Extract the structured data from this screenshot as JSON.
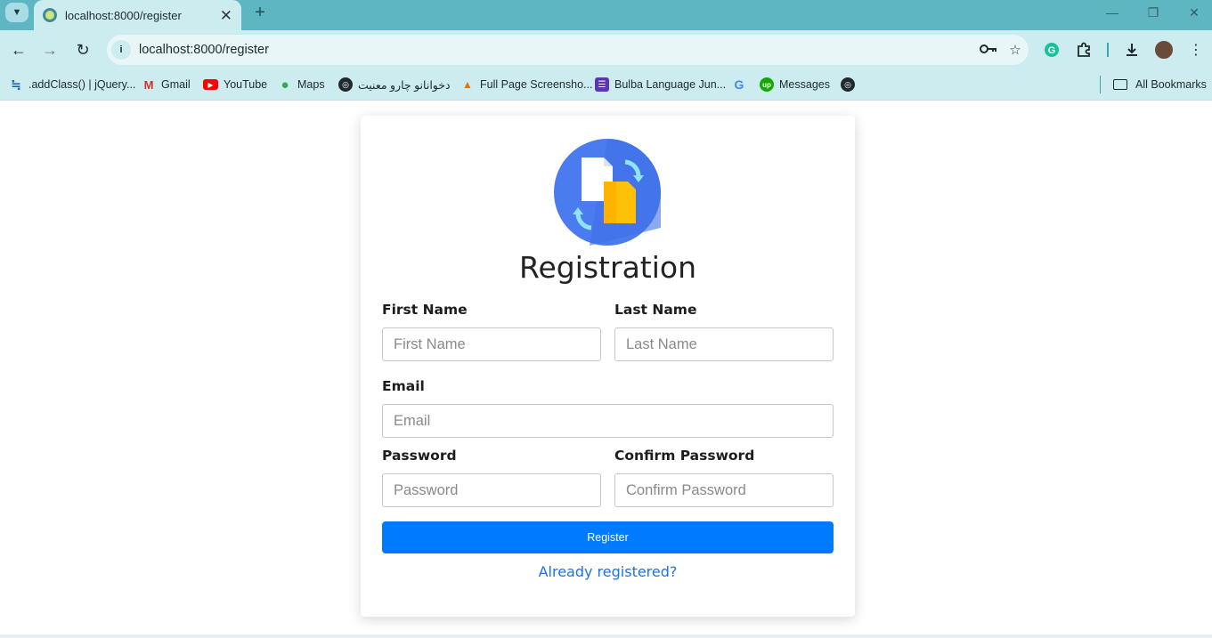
{
  "browser": {
    "tab_title": "localhost:8000/register",
    "url": "localhost:8000/register",
    "bookmarks": [
      {
        "label": ".addClass() | jQuery...",
        "icon": "jquery-icon"
      },
      {
        "label": "Gmail",
        "icon": "gmail-icon"
      },
      {
        "label": "YouTube",
        "icon": "youtube-icon"
      },
      {
        "label": "Maps",
        "icon": "maps-icon"
      },
      {
        "label": "دخوانانو چارو معنیت",
        "icon": "globe-icon"
      },
      {
        "label": "Full Page Screensho...",
        "icon": "screenshot-icon"
      },
      {
        "label": "Bulba Language Jun...",
        "icon": "list-icon"
      },
      {
        "label": "",
        "icon": "google-icon"
      },
      {
        "label": "Messages",
        "icon": "upwork-icon"
      },
      {
        "label": "",
        "icon": "globe-icon"
      }
    ],
    "all_bookmarks_label": "All Bookmarks"
  },
  "form": {
    "heading": "Registration",
    "first_name": {
      "label": "First Name",
      "placeholder": "First Name",
      "value": ""
    },
    "last_name": {
      "label": "Last Name",
      "placeholder": "Last Name",
      "value": ""
    },
    "email": {
      "label": "Email",
      "placeholder": "Email",
      "value": ""
    },
    "password": {
      "label": "Password",
      "placeholder": "Password",
      "value": ""
    },
    "confirm_password": {
      "label": "Confirm Password",
      "placeholder": "Confirm Password",
      "value": ""
    },
    "submit_label": "Register",
    "login_link": "Already registered?"
  },
  "colors": {
    "tabbar": "#5eb6c3",
    "toolbar": "#cdecf0",
    "primary_button": "#007bff",
    "link": "#1a73e8",
    "logo_circle": "#4a7cf0",
    "logo_doc_front": "#ffc107"
  }
}
